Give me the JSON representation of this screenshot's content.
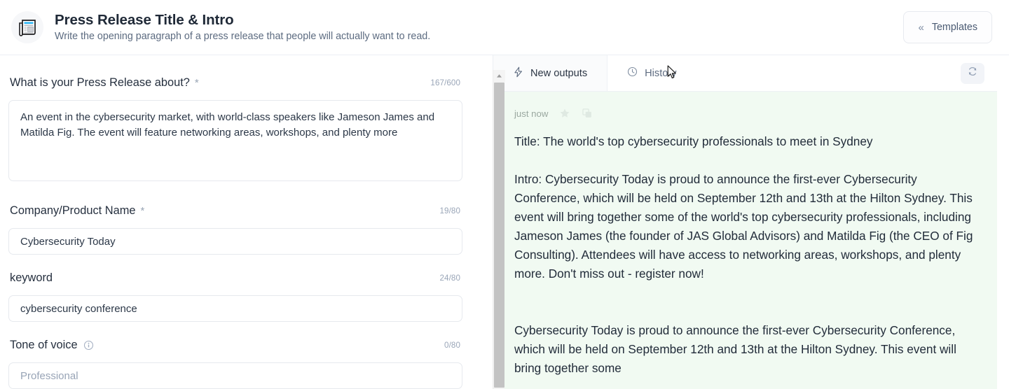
{
  "header": {
    "icon": "newspaper-icon",
    "title": "Press Release Title & Intro",
    "subtitle": "Write the opening paragraph of a press release that people will actually want to read.",
    "templates_button": {
      "label": "Templates",
      "icon": "double-chevron-left-icon",
      "chevron": "«"
    }
  },
  "form": {
    "fields": [
      {
        "label": "What is your Press Release about?",
        "required": true,
        "required_marker": "*",
        "counter": "167/600",
        "type": "textarea",
        "value": "An event in the cybersecurity market, with world-class speakers like Jameson James and Matilda Fig. The event will feature networking areas, workshops, and plenty more",
        "placeholder": ""
      },
      {
        "label": "Company/Product Name",
        "required": true,
        "required_marker": "*",
        "counter": "19/80",
        "type": "text",
        "value": "Cybersecurity Today",
        "placeholder": ""
      },
      {
        "label": "keyword",
        "required": false,
        "required_marker": "",
        "counter": "24/80",
        "type": "text",
        "value": "cybersecurity conference",
        "placeholder": ""
      },
      {
        "label": "Tone of voice",
        "required": false,
        "required_marker": "",
        "has_info_icon": true,
        "info_icon": "info-circle-icon",
        "counter": "0/80",
        "type": "text",
        "value": "",
        "placeholder": "Professional"
      }
    ]
  },
  "output_panel": {
    "tabs": [
      {
        "label": "New outputs",
        "icon": "lightning-bolt-icon",
        "active": true
      },
      {
        "label": "History",
        "icon": "clock-icon",
        "active": false
      }
    ],
    "refresh_button": {
      "icon": "refresh-icon",
      "label": ""
    },
    "result": {
      "timestamp": "just now",
      "favorite_icon": "star-icon",
      "copy_icon": "copy-icon",
      "text": "Title: The world's top cybersecurity professionals to meet in Sydney\n\nIntro: Cybersecurity Today is proud to announce the first-ever Cybersecurity Conference, which will be held on September 12th and 13th at the Hilton Sydney. This event will bring together some of the world's top cybersecurity professionals, including Jameson James (the founder of JAS Global Advisors) and Matilda Fig (the CEO of Fig Consulting). Attendees will have access to networking areas, workshops, and plenty more. Don't miss out - register now!\n\n\nCybersecurity Today is proud to announce the first-ever Cybersecurity Conference, which will be held on September 12th and 13th at the Hilton Sydney. This event will bring together some"
    }
  },
  "colors": {
    "output_background": "#f1faf2",
    "accent_icon_blue": "#29b6f6",
    "text_primary": "#222c3a",
    "text_muted": "#9aa6b8",
    "border": "#e6e9ee"
  },
  "scrollbar": {
    "name": "left-pane-scrollbar",
    "position": "right-of-form"
  }
}
